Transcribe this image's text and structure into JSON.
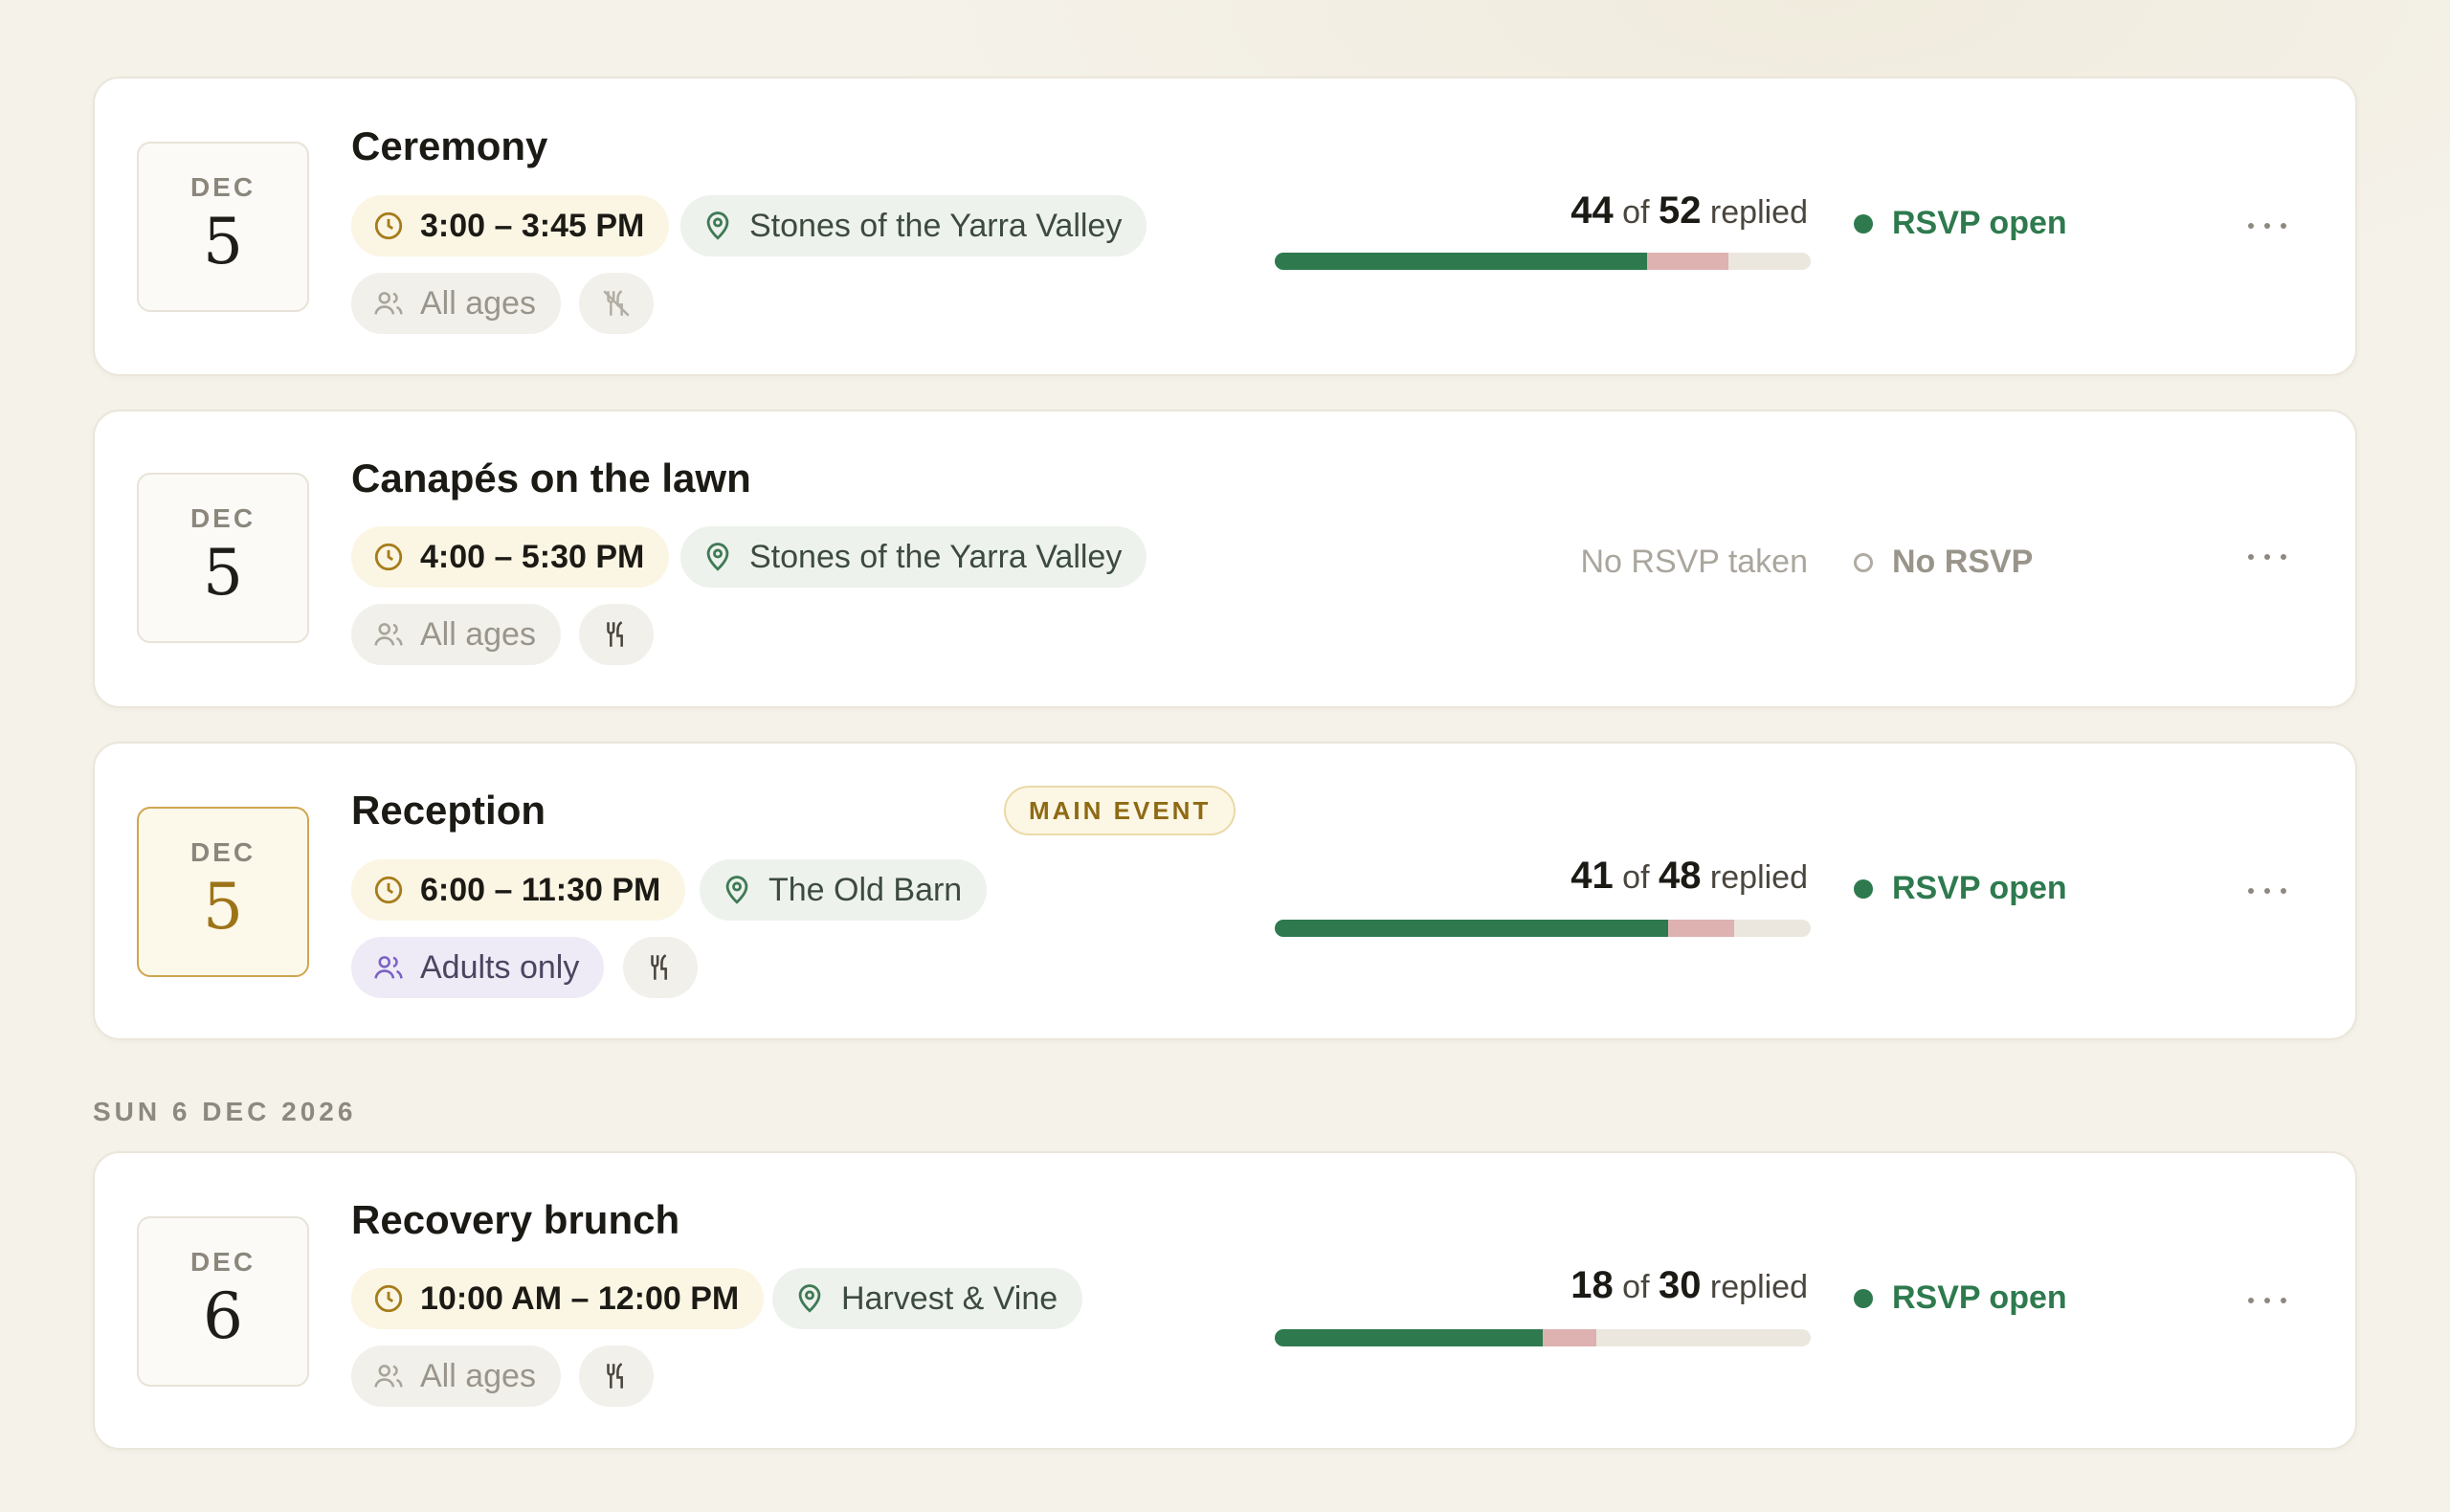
{
  "colors": {
    "accent_green": "#2e7a4e",
    "declined_pink": "#ddb2b0",
    "gold": "#cfa64f",
    "background": "#f5f2ea"
  },
  "events": [
    {
      "month": "DEC",
      "day": "5",
      "title": "Ceremony",
      "time": "3:00 – 3:45 PM",
      "location": "Stones of the Yarra Valley",
      "audience": "All ages",
      "food_icon": "no-food-icon",
      "replied_count": "44",
      "replied_of": "of",
      "replied_total": "52",
      "replied_word": "replied",
      "accepted_fraction": 0.6939,
      "declined_fraction": 0.1531,
      "status": "RSVP open"
    },
    {
      "month": "DEC",
      "day": "5",
      "title": "Canapés on the lawn",
      "time": "4:00 – 5:30 PM",
      "location": "Stones of the Yarra Valley",
      "audience": "All ages",
      "food_icon": "utensils-icon",
      "rsvp_note": "No RSVP taken",
      "status": "No RSVP"
    },
    {
      "month": "DEC",
      "day": "5",
      "title": "Reception",
      "badge": "MAIN EVENT",
      "time": "6:00 – 11:30 PM",
      "location": "The Old Barn",
      "audience": "Adults only",
      "food_icon": "utensils-icon",
      "replied_count": "41",
      "replied_of": "of",
      "replied_total": "48",
      "replied_word": "replied",
      "accepted_fraction": 0.7347,
      "declined_fraction": 0.1224,
      "status": "RSVP open"
    },
    {
      "month": "DEC",
      "day": "6",
      "title": "Recovery brunch",
      "time": "10:00 AM – 12:00 PM",
      "location": "Harvest & Vine",
      "audience": "All ages",
      "food_icon": "utensils-icon",
      "replied_count": "18",
      "replied_of": "of",
      "replied_total": "30",
      "replied_word": "replied",
      "accepted_fraction": 0.5,
      "declined_fraction": 0.1,
      "status": "RSVP open"
    }
  ],
  "sections": {
    "sun_label": "SUN 6 DEC 2026"
  }
}
